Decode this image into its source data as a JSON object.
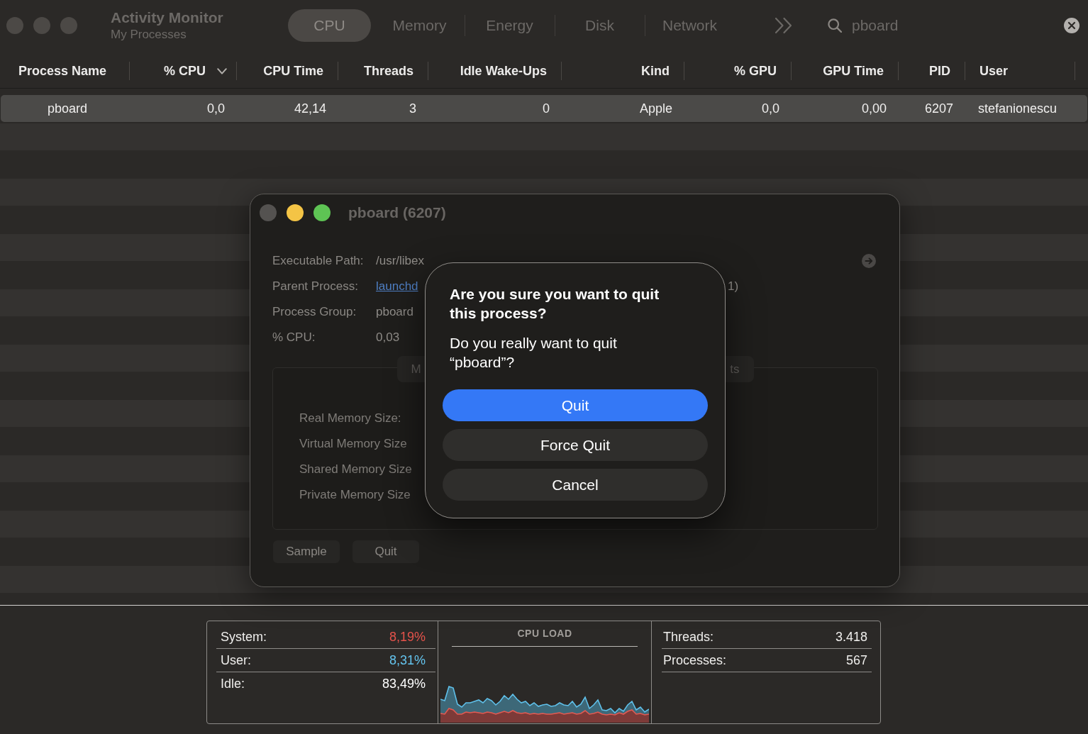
{
  "window": {
    "title": "Activity Monitor",
    "subtitle": "My Processes"
  },
  "tabs": [
    {
      "label": "CPU",
      "selected": true
    },
    {
      "label": "Memory",
      "selected": false
    },
    {
      "label": "Energy",
      "selected": false
    },
    {
      "label": "Disk",
      "selected": false
    },
    {
      "label": "Network",
      "selected": false
    }
  ],
  "search": {
    "value": "pboard"
  },
  "table": {
    "columns": [
      {
        "label": "Process Name",
        "sorted": false
      },
      {
        "label": "% CPU",
        "sorted": true
      },
      {
        "label": "CPU Time",
        "sorted": false
      },
      {
        "label": "Threads",
        "sorted": false
      },
      {
        "label": "Idle Wake-Ups",
        "sorted": false
      },
      {
        "label": "Kind",
        "sorted": false
      },
      {
        "label": "% GPU",
        "sorted": false
      },
      {
        "label": "GPU Time",
        "sorted": false
      },
      {
        "label": "PID",
        "sorted": false
      },
      {
        "label": "User",
        "sorted": false
      }
    ],
    "rows": [
      {
        "selected": true,
        "cells": [
          "pboard",
          "0,0",
          "42,14",
          "3",
          "0",
          "Apple",
          "0,0",
          "0,00",
          "6207",
          "stefanionescu"
        ]
      }
    ]
  },
  "process_window": {
    "title": "pboard (6207)",
    "fields": [
      {
        "label": "Executable Path:",
        "value": "/usr/libex",
        "kind": "text"
      },
      {
        "label": "Parent Process:",
        "value": "launchd",
        "kind": "link",
        "right_column_value": "1)"
      },
      {
        "label": "Process Group:",
        "value": "pboard",
        "kind": "text"
      },
      {
        "label": "% CPU:",
        "value": "0,03",
        "kind": "text"
      }
    ],
    "tabs": [
      {
        "label": "M"
      },
      {
        "label": "ts"
      }
    ],
    "memory_labels": [
      "Real Memory Size:",
      "Virtual Memory Size",
      "Shared Memory Size",
      "Private Memory Size"
    ],
    "buttons": [
      {
        "label": "Sample"
      },
      {
        "label": "Quit"
      }
    ]
  },
  "dialog": {
    "title": "Are you sure you want to quit this process?",
    "message": "Do you really want to quit “pboard”?",
    "buttons": [
      {
        "label": "Quit",
        "kind": "default"
      },
      {
        "label": "Force Quit",
        "kind": "normal"
      },
      {
        "label": "Cancel",
        "kind": "normal"
      }
    ]
  },
  "cpu_summary": {
    "rows": [
      {
        "label": "System:",
        "value": "8,19%",
        "color": "#e5534b"
      },
      {
        "label": "User:",
        "value": "8,31%",
        "color": "#64c4ee"
      },
      {
        "label": "Idle:",
        "value": "83,49%",
        "color": "#ffffff"
      }
    ]
  },
  "cpu_load": {
    "title": "CPU LOAD"
  },
  "counts": {
    "rows": [
      {
        "label": "Threads:",
        "value": "3.418"
      },
      {
        "label": "Processes:",
        "value": "567"
      }
    ]
  }
}
